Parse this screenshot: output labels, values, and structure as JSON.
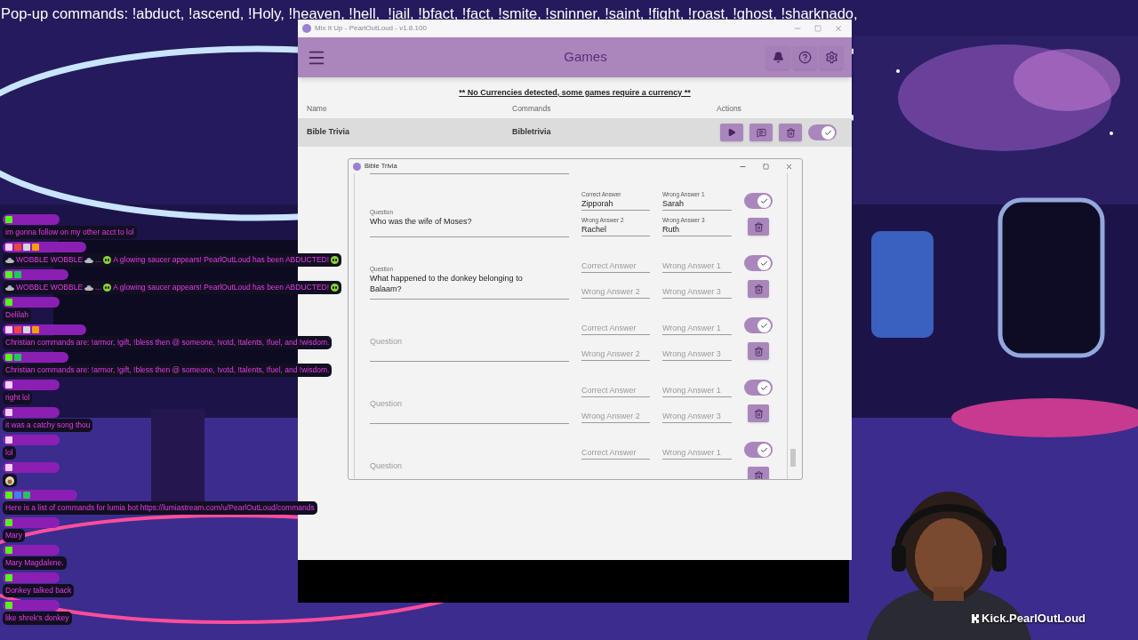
{
  "overlay_title": "Pop-up commands: !abduct, !ascend, !Holy, !heaven, !hell,  !jail, !bfact, !fact, !smite, !sninner, !saint, !fight, !roast, !ghost, !sharknado,",
  "chat": [
    {
      "badges": [
        {
          "color": "#53fc18"
        }
      ],
      "segments": [
        {
          "kind": "text",
          "text": "im gonna follow on my other acct to lol"
        }
      ]
    },
    {
      "badges": [
        {
          "color": "#f5d0fe"
        },
        {
          "color": "#ef4444"
        },
        {
          "color": "#d4d4d8"
        },
        {
          "color": "#f59e0b"
        }
      ],
      "segments": [
        {
          "kind": "saucer"
        },
        {
          "kind": "text",
          "text": "WOBBLE WOBBLE"
        },
        {
          "kind": "saucer"
        },
        {
          "kind": "text",
          "text": "..."
        },
        {
          "kind": "alien"
        },
        {
          "kind": "text",
          "text": "A glowing saucer appears! PearlOutLoud has been ABDUCTED!"
        },
        {
          "kind": "alien"
        }
      ]
    },
    {
      "badges": [
        {
          "color": "#53fc18"
        },
        {
          "color": "#22c55e"
        }
      ],
      "segments": [
        {
          "kind": "saucer"
        },
        {
          "kind": "text",
          "text": "WOBBLE WOBBLE"
        },
        {
          "kind": "saucer"
        },
        {
          "kind": "text",
          "text": "..."
        },
        {
          "kind": "alien"
        },
        {
          "kind": "text",
          "text": "A glowing saucer appears! PearlOutLoud has been ABDUCTED!"
        },
        {
          "kind": "alien"
        }
      ]
    },
    {
      "badges": [
        {
          "color": "#53fc18"
        }
      ],
      "segments": [
        {
          "kind": "text",
          "text": "Delilah"
        }
      ]
    },
    {
      "badges": [
        {
          "color": "#f5d0fe"
        },
        {
          "color": "#ef4444"
        },
        {
          "color": "#d4d4d8"
        },
        {
          "color": "#f59e0b"
        }
      ],
      "segments": [
        {
          "kind": "text",
          "text": "Christian commands are: !armor, !gift, !bless then @ someone, !votd, !talents, !fuel, and !wisdom."
        }
      ]
    },
    {
      "badges": [
        {
          "color": "#53fc18"
        },
        {
          "color": "#22c55e"
        }
      ],
      "segments": [
        {
          "kind": "text",
          "text": "Christian commands are: !armor, !gift, !bless then @ someone, !votd, !talents, !fuel, and !wisdom."
        }
      ]
    },
    {
      "badges": [
        {
          "color": "#f5d0fe"
        }
      ],
      "segments": [
        {
          "kind": "text",
          "text": "right lol"
        }
      ]
    },
    {
      "badges": [
        {
          "color": "#f5d0fe"
        }
      ],
      "segments": [
        {
          "kind": "text",
          "text": "it was a catchy song thou"
        }
      ]
    },
    {
      "badges": [
        {
          "color": "#f5d0fe"
        }
      ],
      "segments": [
        {
          "kind": "text",
          "text": "lol"
        }
      ]
    },
    {
      "badges": [
        {
          "color": "#f5d0fe"
        }
      ],
      "segments": [
        {
          "kind": "sticker"
        }
      ]
    },
    {
      "badges": [
        {
          "color": "#53fc18"
        },
        {
          "color": "#3b82f6"
        },
        {
          "color": "#22c55e"
        }
      ],
      "segments": [
        {
          "kind": "text",
          "text": "Here is a list of commands for lumia bot https://lumiastream.com/u/PearlOutLoud/commands"
        }
      ]
    },
    {
      "badges": [
        {
          "color": "#53fc18"
        }
      ],
      "segments": [
        {
          "kind": "text",
          "text": "Mary"
        }
      ]
    },
    {
      "badges": [
        {
          "color": "#53fc18"
        }
      ],
      "segments": [
        {
          "kind": "text",
          "text": "Mary Magdalene."
        }
      ]
    },
    {
      "badges": [
        {
          "color": "#53fc18"
        }
      ],
      "segments": [
        {
          "kind": "text",
          "text": "Donkey talked back"
        }
      ]
    },
    {
      "badges": [
        {
          "color": "#53fc18"
        }
      ],
      "segments": [
        {
          "kind": "text",
          "text": "like shrek's donkey"
        }
      ]
    }
  ],
  "app": {
    "window_title": "Mix It Up - PearlOutLoud - v1.8.100",
    "page_title": "Games",
    "notice": "** No Currencies detected, some games require a currency **",
    "columns": [
      "Name",
      "Commands",
      "Actions"
    ],
    "rows": [
      {
        "name": "Bible Trivia",
        "command": "Bibletrivia",
        "enabled": true
      }
    ],
    "dialog": {
      "title": "Bible Trivia",
      "questions": [
        {
          "question": {
            "label": "Question",
            "value": "Who was the wife of Moses?"
          },
          "answers": [
            {
              "label": "Correct Answer",
              "value": "Zipporah"
            },
            {
              "label": "Wrong Answer 1",
              "value": "Sarah"
            },
            {
              "label": "Wrong Answer 2",
              "value": "Rachel"
            },
            {
              "label": "Wrong Answer 3",
              "value": "Ruth"
            }
          ],
          "enabled": true
        },
        {
          "question": {
            "label": "Question",
            "value": "What happened to the donkey belonging to Balaam?"
          },
          "answers": [
            {
              "label": "Correct Answer"
            },
            {
              "label": "Wrong Answer 1"
            },
            {
              "label": "Wrong Answer 2"
            },
            {
              "label": "Wrong Answer 3"
            }
          ],
          "enabled": true
        },
        {
          "question": {
            "label": "Question"
          },
          "answers": [
            {
              "label": "Correct Answer"
            },
            {
              "label": "Wrong Answer 1"
            },
            {
              "label": "Wrong Answer 2"
            },
            {
              "label": "Wrong Answer 3"
            }
          ],
          "enabled": true
        },
        {
          "question": {
            "label": "Question"
          },
          "answers": [
            {
              "label": "Correct Answer"
            },
            {
              "label": "Wrong Answer 1"
            },
            {
              "label": "Wrong Answer 2"
            },
            {
              "label": "Wrong Answer 3"
            }
          ],
          "enabled": true
        },
        {
          "question": {
            "label": "Question"
          },
          "answers": [
            {
              "label": "Correct Answer"
            },
            {
              "label": "Wrong Answer 1"
            }
          ],
          "enabled": true
        }
      ]
    }
  },
  "webcam": {
    "caption": "Kick.PearlOutLoud"
  }
}
